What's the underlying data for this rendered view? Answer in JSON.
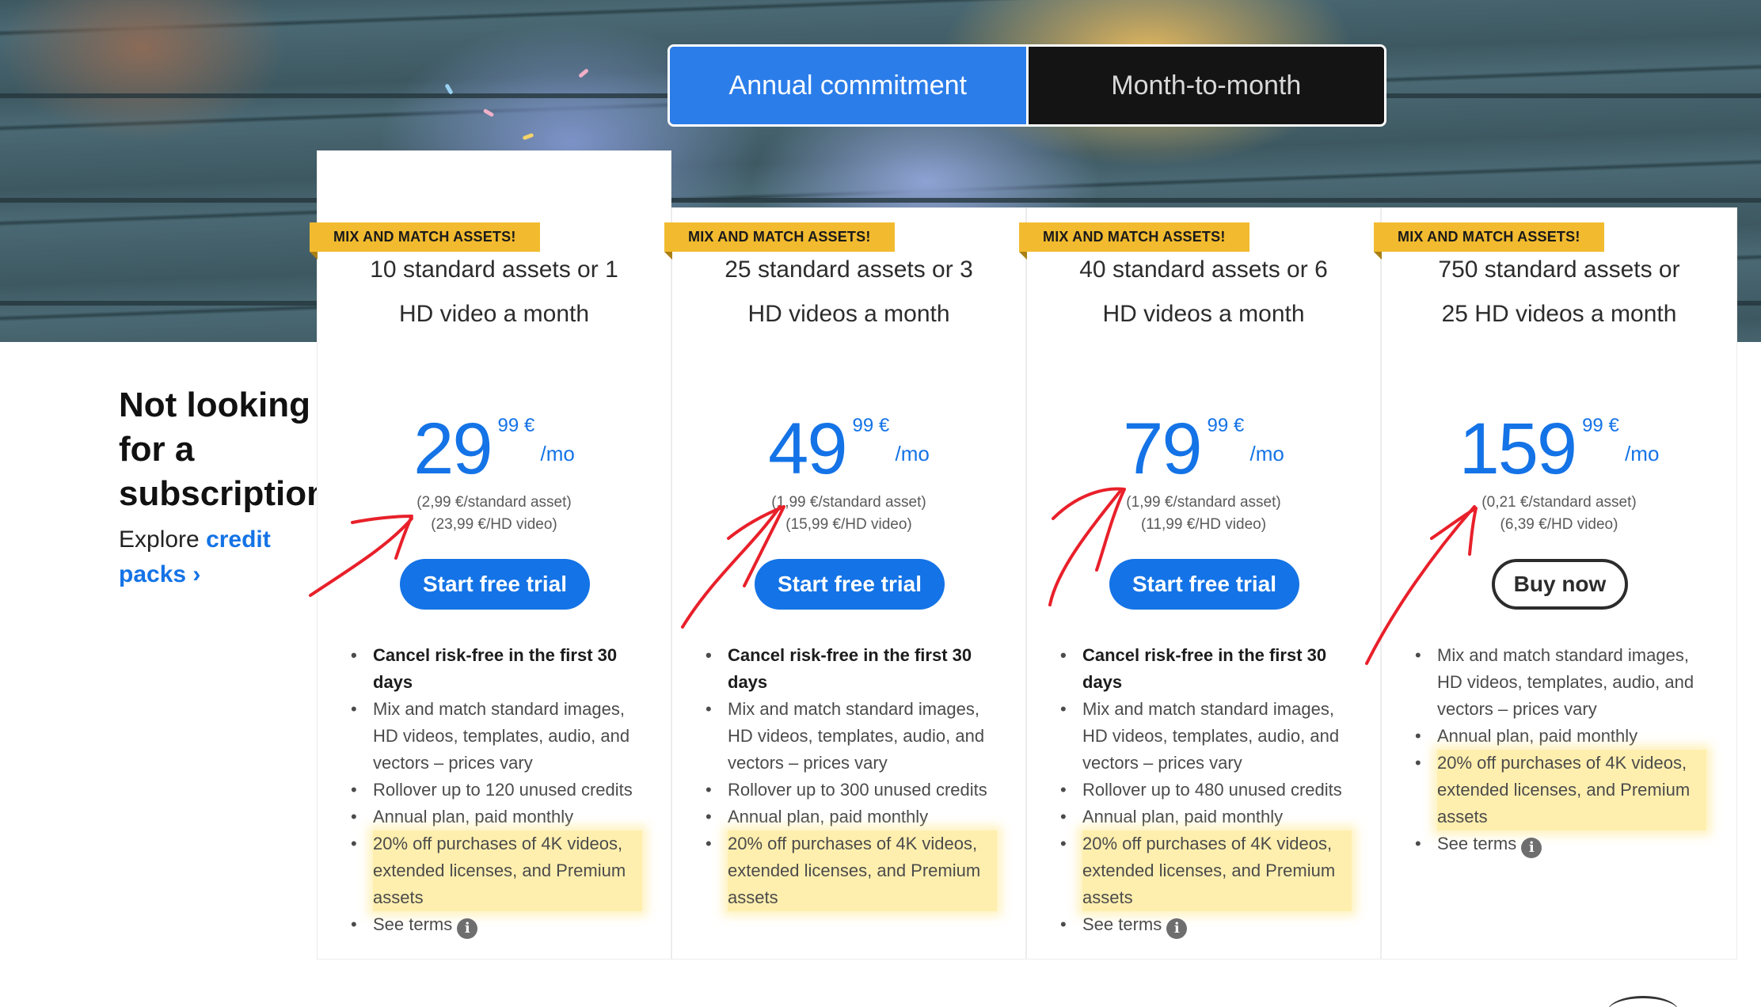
{
  "billing_toggle": {
    "annual_label": "Annual commitment",
    "monthly_label": "Month-to-month"
  },
  "promo": {
    "heading": "Not looking for a subscription?",
    "explore_text": "Explore ",
    "link_text": "credit packs ›"
  },
  "plans": [
    {
      "badge": "MIX AND MATCH ASSETS!",
      "title": "10 standard assets or 1 HD video a month",
      "price_whole": "29",
      "price_cents": "99 €",
      "price_period": "/mo",
      "per_asset": "(2,99 €/standard asset)",
      "per_video": "(23,99 €/HD video)",
      "cta": "Start free trial",
      "features": [
        "Cancel risk-free in the first 30 days",
        "Mix and match standard images, HD videos, templates, audio, and vectors – prices vary",
        "Rollover up to 120 unused credits",
        "Annual plan, paid monthly",
        "20% off purchases of 4K videos, extended licenses, and Premium assets",
        "See terms"
      ]
    },
    {
      "badge": "MIX AND MATCH ASSETS!",
      "title": "25 standard assets or 3 HD videos a month",
      "price_whole": "49",
      "price_cents": "99 €",
      "price_period": "/mo",
      "per_asset": "(1,99 €/standard asset)",
      "per_video": "(15,99 €/HD video)",
      "cta": "Start free trial",
      "features": [
        "Cancel risk-free in the first 30 days",
        "Mix and match standard images, HD videos, templates, audio, and vectors – prices vary",
        "Rollover up to 300 unused credits",
        "Annual plan, paid monthly",
        "20% off purchases of 4K videos, extended licenses, and Premium assets"
      ]
    },
    {
      "badge": "MIX AND MATCH ASSETS!",
      "title": "40 standard assets or 6 HD videos a month",
      "price_whole": "79",
      "price_cents": "99 €",
      "price_period": "/mo",
      "per_asset": "(1,99 €/standard asset)",
      "per_video": "(11,99 €/HD video)",
      "cta": "Start free trial",
      "features": [
        "Cancel risk-free in the first 30 days",
        "Mix and match standard images, HD videos, templates, audio, and vectors – prices vary",
        "Rollover up to 480 unused credits",
        "Annual plan, paid monthly",
        "20% off purchases of 4K videos, extended licenses, and Premium assets",
        "See terms"
      ]
    },
    {
      "badge": "MIX AND MATCH ASSETS!",
      "title": "750 standard assets or 25 HD videos a month",
      "price_whole": "159",
      "price_cents": "99 €",
      "price_period": "/mo",
      "per_asset": "(0,21 €/standard asset)",
      "per_video": "(6,39 €/HD video)",
      "cta": "Buy now",
      "features": [
        "Mix and match standard images, HD videos, templates, audio, and vectors – prices vary",
        "Annual plan, paid monthly",
        "20% off purchases of 4K videos, extended licenses, and Premium assets",
        "See terms"
      ]
    }
  ],
  "icons": {
    "info": "info-icon",
    "link_chevron": "chevron-right-icon"
  },
  "colors": {
    "accent": "#1473e6",
    "toggle_active": "#2b7de9",
    "badge": "#f2bb2f",
    "highlight": "#ffe26e",
    "annotation": "#e8202a"
  }
}
